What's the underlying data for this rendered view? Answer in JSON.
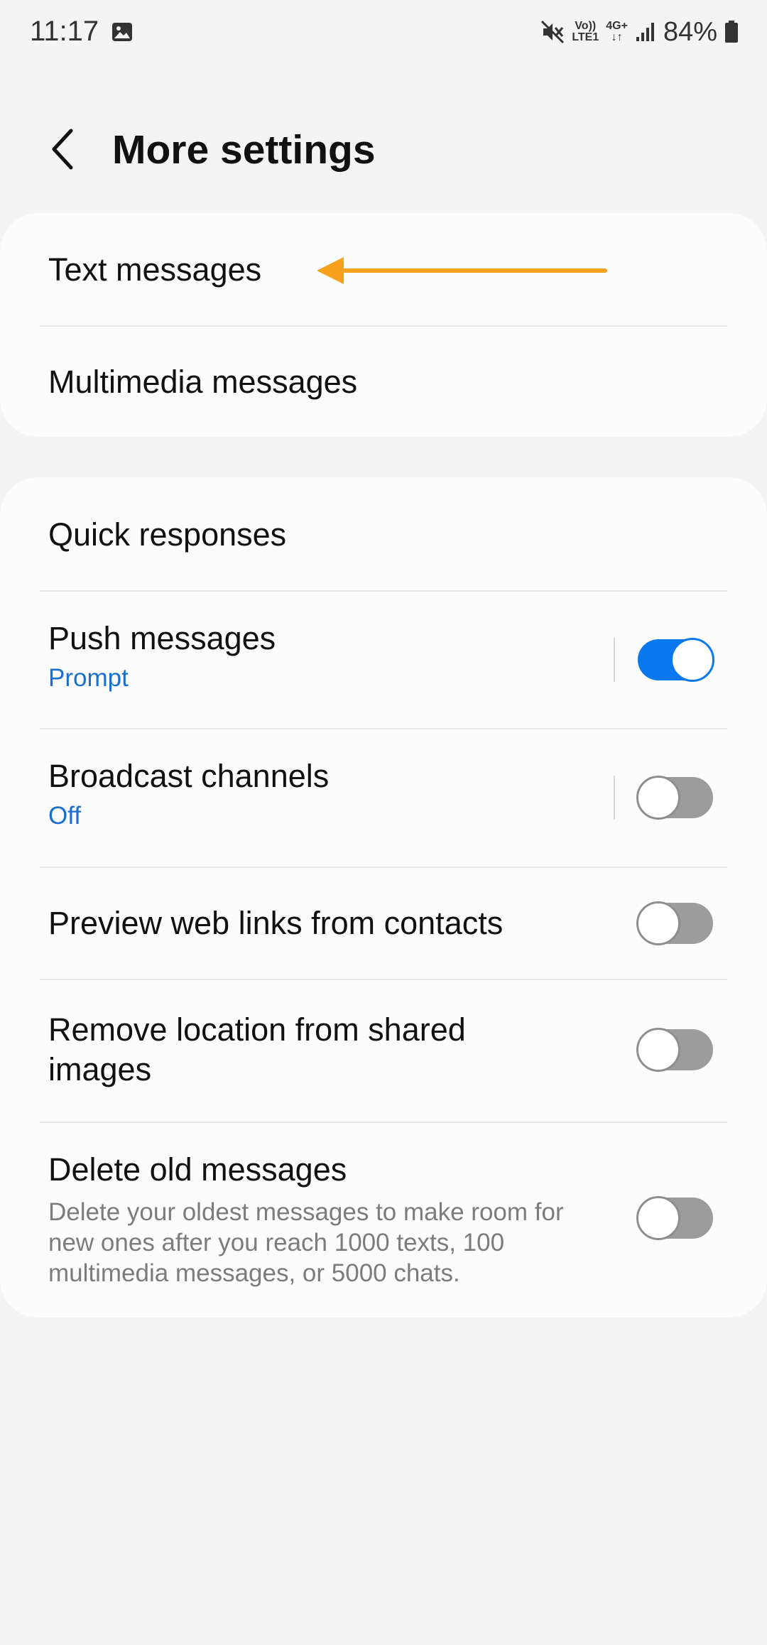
{
  "status_bar": {
    "time": "11:17",
    "volte_line1": "Vo))",
    "volte_line2": "LTE1",
    "network_type": "4G+",
    "battery_percent": "84%",
    "icons": [
      "gallery-icon",
      "mute-icon",
      "signal-icon",
      "battery-icon"
    ]
  },
  "header": {
    "title": "More settings",
    "back_icon": "chevron-left-icon"
  },
  "group1": {
    "text_messages": "Text messages",
    "multimedia_messages": "Multimedia messages"
  },
  "group2": {
    "quick_responses": "Quick responses",
    "push_messages": {
      "title": "Push messages",
      "subtitle": "Prompt",
      "enabled": true
    },
    "broadcast_channels": {
      "title": "Broadcast channels",
      "subtitle": "Off",
      "enabled": false
    },
    "preview_web_links": {
      "title": "Preview web links from contacts",
      "enabled": false
    },
    "remove_location": {
      "title": "Remove location from shared images",
      "enabled": false
    },
    "delete_old_messages": {
      "title": "Delete old messages",
      "description": "Delete your oldest messages to make room for new ones after you reach 1000 texts, 100 multimedia messages, or 5000 chats.",
      "enabled": false
    }
  },
  "colors": {
    "accent": "#0a79f0",
    "subtitle": "#1a6fd0",
    "annotation_arrow": "#f7a01c",
    "background": "#f4f4f4",
    "card": "#fcfcfc"
  }
}
